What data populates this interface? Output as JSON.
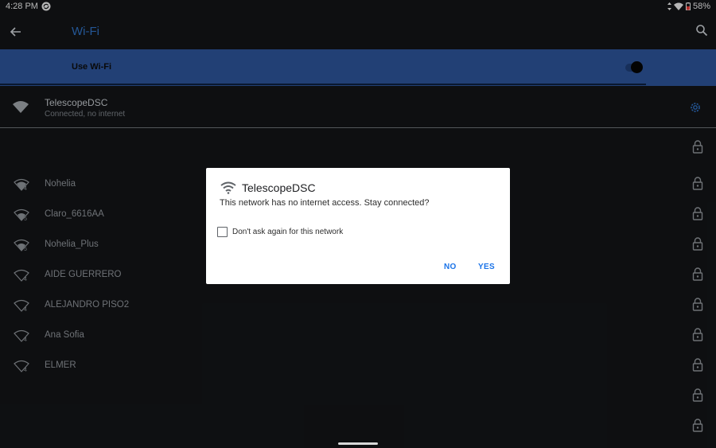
{
  "status_bar": {
    "time": "4:28 PM",
    "battery": "58%"
  },
  "app_bar": {
    "title": "Wi-Fi"
  },
  "wifi_toggle": {
    "label": "Use Wi-Fi",
    "on": true
  },
  "connected_network": {
    "name": "TelescopeDSC",
    "status": "Connected, no internet"
  },
  "networks": [
    {
      "name": "",
      "locked": true
    },
    {
      "name": "Nohelia",
      "band": "4",
      "locked": true
    },
    {
      "name": "Claro_6616AA",
      "band": "5",
      "locked": true
    },
    {
      "name": "Nohelia_Plus",
      "band": "5",
      "locked": true
    },
    {
      "name": "AIDE GUERRERO",
      "band": "4",
      "locked": true
    },
    {
      "name": "ALEJANDRO PISO2",
      "band": "4",
      "locked": true
    },
    {
      "name": "Ana Sofia",
      "band": "4",
      "locked": true
    },
    {
      "name": "ELMER",
      "band": "4",
      "locked": true
    },
    {
      "name": "",
      "locked": true
    },
    {
      "name": "",
      "locked": true
    }
  ],
  "dialog": {
    "title": "TelescopeDSC",
    "message": "This network has no internet access. Stay connected?",
    "checkbox_label": "Don't ask again for this network",
    "checked": false,
    "no_label": "NO",
    "yes_label": "YES"
  },
  "colors": {
    "accent": "#2f6fbf",
    "toggle_bar": "#2c5297",
    "background": "#121417",
    "dialog_button": "#1a73e8"
  }
}
